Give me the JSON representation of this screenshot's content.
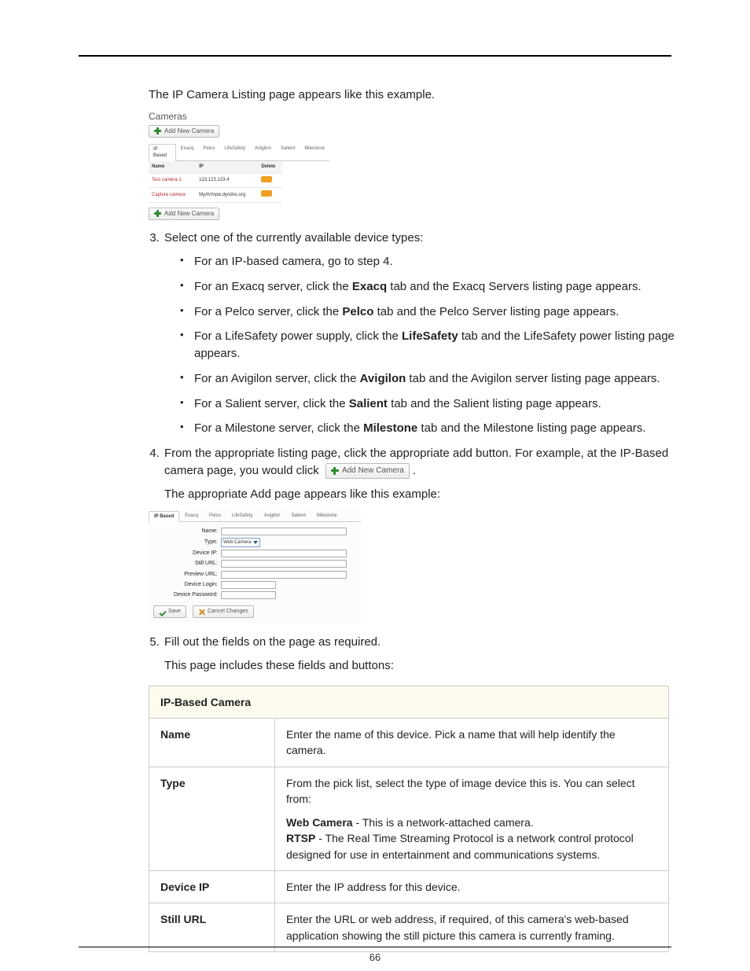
{
  "page_number": "66",
  "intro_line": "The IP Camera Listing page appears like this example.",
  "shot1": {
    "title": "Cameras",
    "add_label": "Add New Camera",
    "tabs": [
      "IP Based",
      "Exacq",
      "Pelco",
      "LifeSafety",
      "Avigilon",
      "Salient",
      "Milestone"
    ],
    "headers": {
      "name": "Name",
      "ip": "IP",
      "delete": "Delete"
    },
    "rows": [
      {
        "name": "Test camera 1",
        "ip": "123.123.123.4"
      },
      {
        "name": "Capture camera",
        "ip": "MyAVmpw.dyndns.org"
      }
    ]
  },
  "step3": {
    "lead": "Select one of the currently available device types:",
    "items": [
      {
        "pre": "For an IP-based camera, go to step 4."
      },
      {
        "pre": "For an Exacq server, click the ",
        "bold": "Exacq",
        "post": " tab and the Exacq Servers listing page appears."
      },
      {
        "pre": "For a Pelco server, click the ",
        "bold": "Pelco",
        "post": " tab and the Pelco Server listing page appears."
      },
      {
        "pre": "For a LifeSafety power supply, click the ",
        "bold": "LifeSafety",
        "post": " tab and the LifeSafety power listing page appears."
      },
      {
        "pre": "For an Avigilon server, click the ",
        "bold": "Avigilon",
        "post": " tab and the Avigilon server listing page appears."
      },
      {
        "pre": "For a Salient server, click the ",
        "bold": "Salient",
        "post": " tab and the Salient listing page appears."
      },
      {
        "pre": "For a Milestone server, click the ",
        "bold": "Milestone",
        "post": " tab and the Milestone listing page appears."
      }
    ]
  },
  "step4": {
    "line1": "From the appropriate listing page, click the appropriate add button. For example, at the IP-Based camera page, you would click",
    "inline_btn": "Add New Camera",
    "after": ".",
    "line2": "The appropriate Add page appears like this example:"
  },
  "shot2": {
    "tabs": [
      "IP Based",
      "Exacq",
      "Pelco",
      "LifeSafety",
      "Avigilon",
      "Salient",
      "Milestone"
    ],
    "labels": {
      "name": "Name:",
      "type": "Type:",
      "type_value": "Web Camera",
      "device_ip": "Device IP:",
      "still_url": "Still URL:",
      "preview_url": "Preview URL:",
      "device_login": "Device Login:",
      "device_password": "Device Password:"
    },
    "save": "Save",
    "cancel": "Cancel Changes"
  },
  "step5": {
    "line1": "Fill out the fields on the page as required.",
    "line2": "This page includes these fields and buttons:"
  },
  "table": {
    "header": "IP-Based Camera",
    "rows": {
      "name": {
        "k": "Name",
        "v": "Enter the name of this device. Pick a name that will help identify the camera."
      },
      "type": {
        "k": "Type",
        "intro": "From the pick list, select the type of image device this is. You can select from:",
        "web_bold": "Web Camera",
        "web_rest": " - This is a network-attached camera.",
        "rtsp_bold": "RTSP",
        "rtsp_rest": " - The Real Time Streaming Protocol is a network control protocol designed for use in entertainment and communications systems."
      },
      "device_ip": {
        "k": "Device IP",
        "v": "Enter the IP address for this device."
      },
      "still_url": {
        "k": "Still URL",
        "v": "Enter the URL or web address, if required, of this camera's web-based application showing the still picture this camera is currently framing."
      }
    }
  }
}
